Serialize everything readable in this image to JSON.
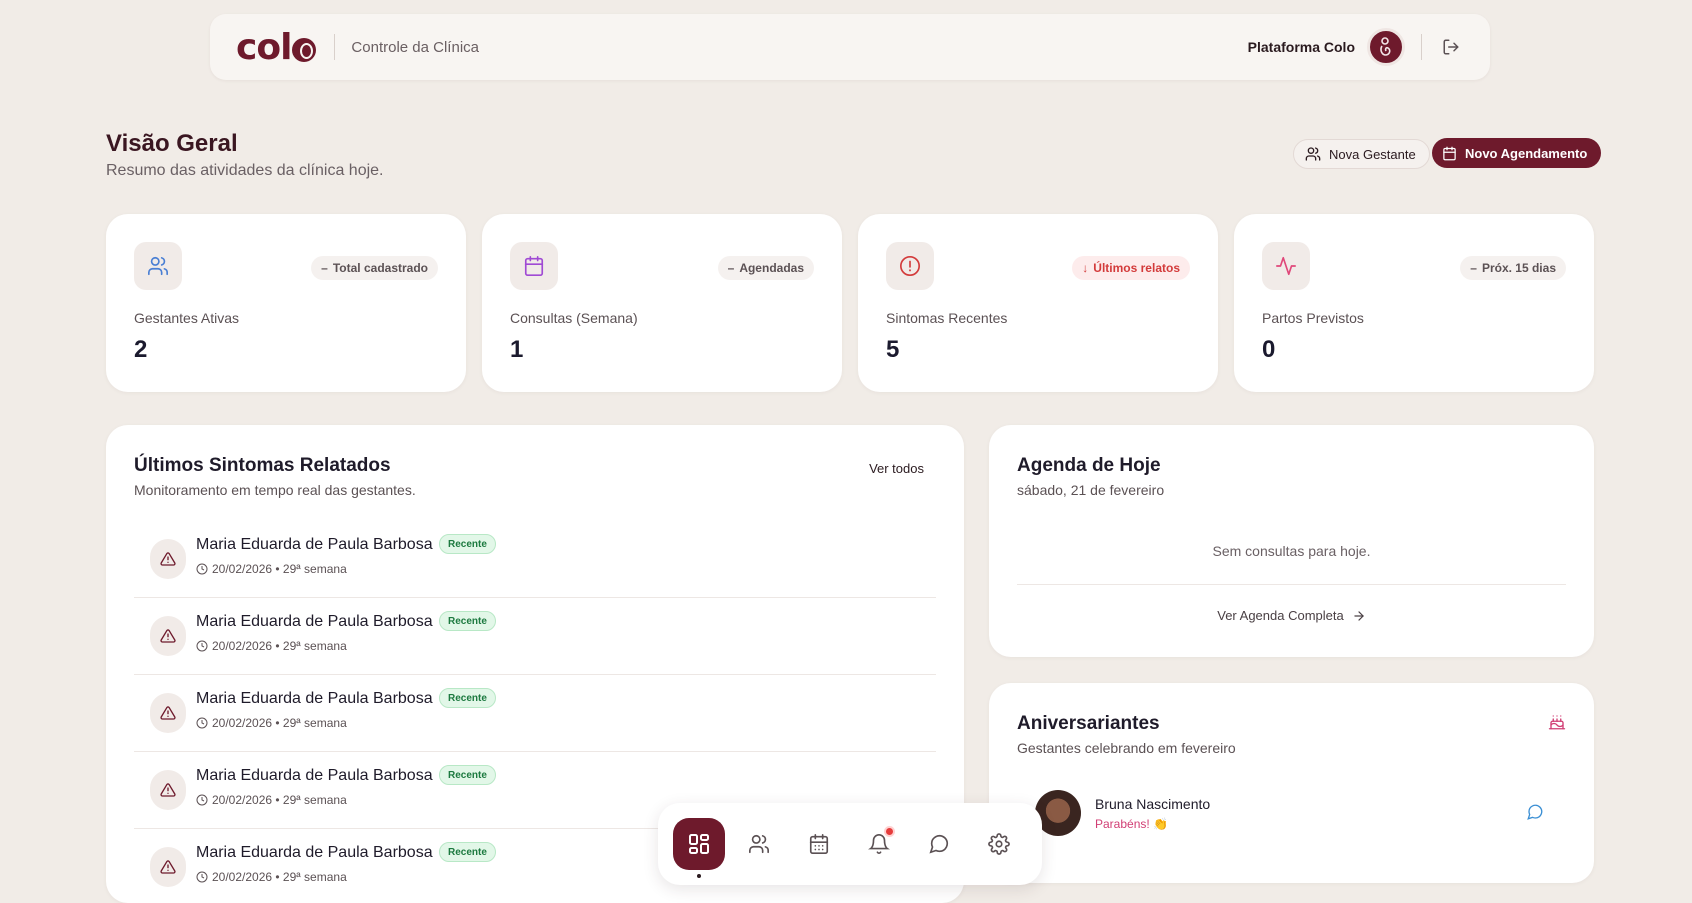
{
  "header": {
    "logo_text": "col",
    "subtitle": "Controle da Clínica",
    "platform": "Plataforma Colo"
  },
  "page": {
    "title": "Visão Geral",
    "subtitle": "Resumo das atividades da clínica hoje.",
    "btn_new_patient": "Nova Gestante",
    "btn_new_appointment": "Novo Agendamento"
  },
  "stats": [
    {
      "icon": "users-icon",
      "tag": "Total cadastrado",
      "label": "Gestantes Ativas",
      "value": "2",
      "color": "#4a7fd4"
    },
    {
      "icon": "calendar-icon",
      "tag": "Agendadas",
      "label": "Consultas (Semana)",
      "value": "1",
      "color": "#a04ad4"
    },
    {
      "icon": "alert-circle-icon",
      "tag": "Últimos relatos",
      "label": "Sintomas Recentes",
      "value": "5",
      "color": "#d33b3b"
    },
    {
      "icon": "activity-icon",
      "tag": "Próx. 15 dias",
      "label": "Partos Previstos",
      "value": "0",
      "color": "#e0487a"
    }
  ],
  "symptoms": {
    "title": "Últimos Sintomas Relatados",
    "subtitle": "Monitoramento em tempo real das gestantes.",
    "see_all": "Ver todos",
    "items": [
      {
        "name": "Maria Eduarda de Paula Barbosa",
        "badge": "Recente",
        "meta": "20/02/2026 • 29ª semana"
      },
      {
        "name": "Maria Eduarda de Paula Barbosa",
        "badge": "Recente",
        "meta": "20/02/2026 • 29ª semana"
      },
      {
        "name": "Maria Eduarda de Paula Barbosa",
        "badge": "Recente",
        "meta": "20/02/2026 • 29ª semana"
      },
      {
        "name": "Maria Eduarda de Paula Barbosa",
        "badge": "Recente",
        "meta": "20/02/2026 • 29ª semana"
      },
      {
        "name": "Maria Eduarda de Paula Barbosa",
        "badge": "Recente",
        "meta": "20/02/2026 • 29ª semana"
      }
    ]
  },
  "agenda": {
    "title": "Agenda de Hoje",
    "date": "sábado, 21 de fevereiro",
    "empty": "Sem consultas para hoje.",
    "full_link": "Ver Agenda Completa"
  },
  "birthdays": {
    "title": "Aniversariantes",
    "subtitle": "Gestantes celebrando em fevereiro",
    "items": [
      {
        "name": "Bruna Nascimento",
        "message": "Parabéns! 👏"
      }
    ]
  },
  "dock": [
    "dashboard-icon",
    "users-icon",
    "calendar-icon",
    "bell-icon",
    "chat-icon",
    "settings-icon"
  ],
  "colors": {
    "brand": "#6e1a2c",
    "background": "#f1ece7",
    "success": "#1d7a40",
    "danger": "#d33b3b"
  }
}
